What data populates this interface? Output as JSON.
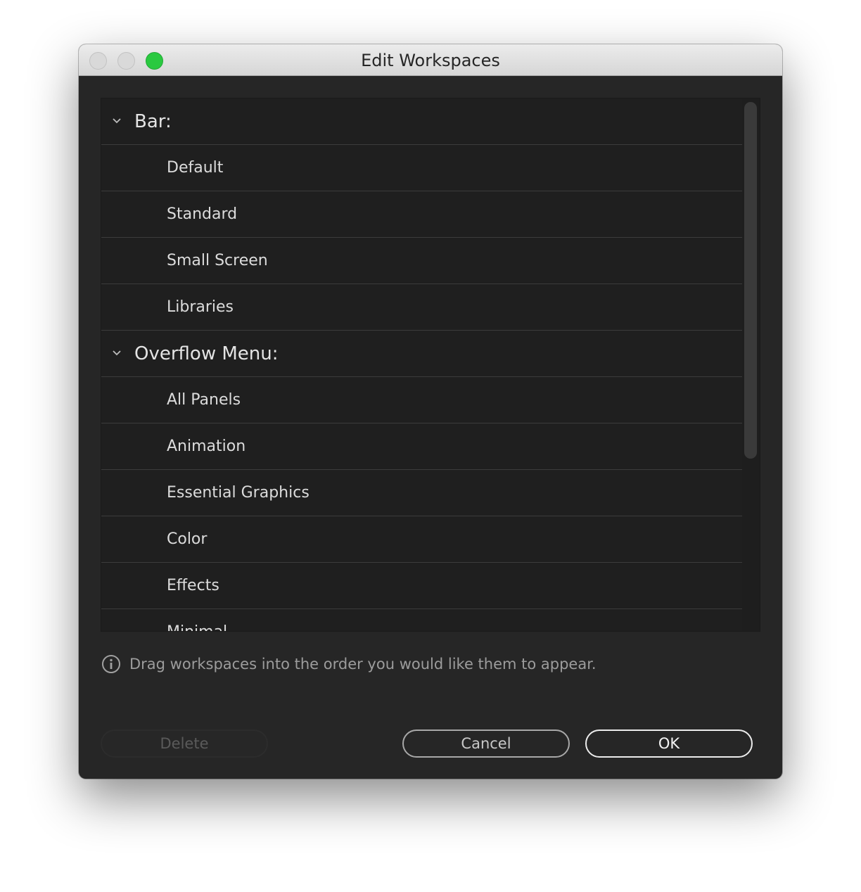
{
  "window": {
    "title": "Edit Workspaces",
    "controls": [
      "close",
      "minimize",
      "zoom"
    ]
  },
  "list": {
    "groups": [
      {
        "label": "Bar:",
        "expanded": true,
        "items": [
          "Default",
          "Standard",
          "Small Screen",
          "Libraries"
        ]
      },
      {
        "label": "Overflow Menu:",
        "expanded": true,
        "items": [
          "All Panels",
          "Animation",
          "Essential Graphics",
          "Color",
          "Effects",
          "Minimal"
        ]
      }
    ]
  },
  "hint": {
    "text": "Drag workspaces into the order you would like them to appear.",
    "icon": "info-icon"
  },
  "buttons": {
    "delete_label": "Delete",
    "delete_enabled": false,
    "cancel_label": "Cancel",
    "ok_label": "OK"
  },
  "colors": {
    "zoom_button": "#2ac940",
    "panel_background": "#262626",
    "list_background": "#1f1f1f"
  }
}
